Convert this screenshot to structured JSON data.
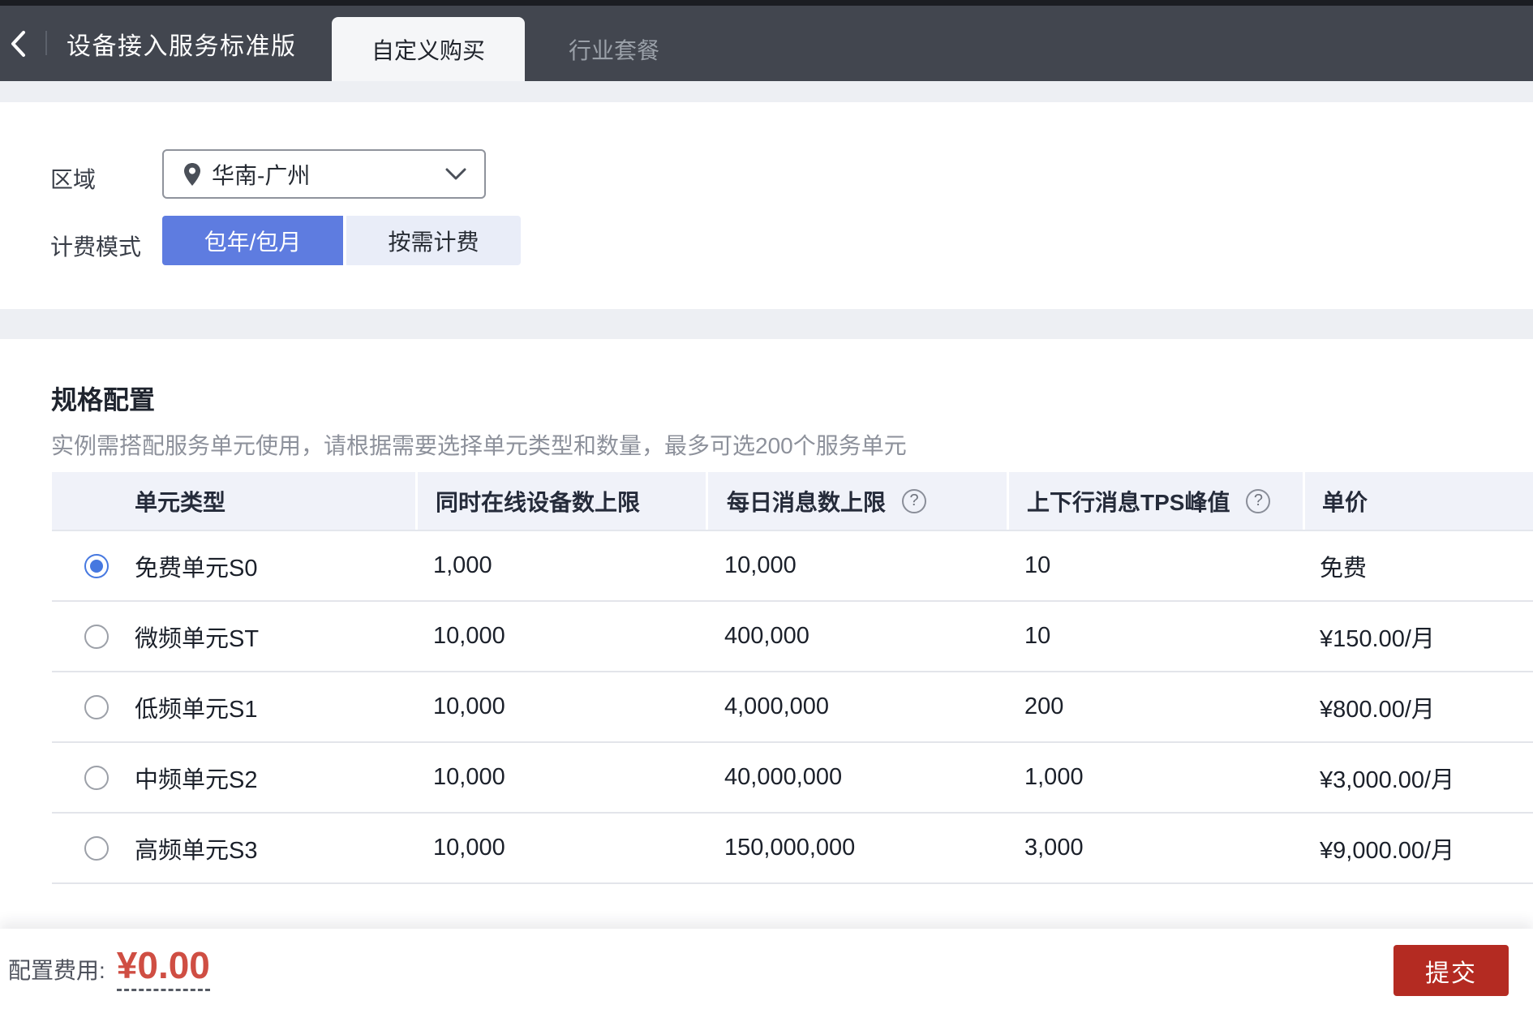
{
  "header": {
    "title": "设备接入服务标准版",
    "tabs": [
      {
        "label": "自定义购买",
        "active": true
      },
      {
        "label": "行业套餐",
        "active": false
      }
    ]
  },
  "form": {
    "region_label": "区域",
    "region_value": "华南-广州",
    "billing_label": "计费模式",
    "billing_options": [
      {
        "label": "包年/包月",
        "selected": true
      },
      {
        "label": "按需计费",
        "selected": false
      }
    ]
  },
  "spec": {
    "heading": "规格配置",
    "description": "实例需搭配服务单元使用，请根据需要选择单元类型和数量，最多可选200个服务单元"
  },
  "table": {
    "columns": [
      {
        "label": "单元类型",
        "help": false
      },
      {
        "label": "同时在线设备数上限",
        "help": false
      },
      {
        "label": "每日消息数上限",
        "help": true
      },
      {
        "label": "上下行消息TPS峰值",
        "help": true
      },
      {
        "label": "单价",
        "help": false
      }
    ],
    "rows": [
      {
        "selected": true,
        "name": "免费单元S0",
        "online": "1,000",
        "daily": "10,000",
        "tps": "10",
        "price": "免费"
      },
      {
        "selected": false,
        "name": "微频单元ST",
        "online": "10,000",
        "daily": "400,000",
        "tps": "10",
        "price": "¥150.00/月"
      },
      {
        "selected": false,
        "name": "低频单元S1",
        "online": "10,000",
        "daily": "4,000,000",
        "tps": "200",
        "price": "¥800.00/月"
      },
      {
        "selected": false,
        "name": "中频单元S2",
        "online": "10,000",
        "daily": "40,000,000",
        "tps": "1,000",
        "price": "¥3,000.00/月"
      },
      {
        "selected": false,
        "name": "高频单元S3",
        "online": "10,000",
        "daily": "150,000,000",
        "tps": "3,000",
        "price": "¥9,000.00/月"
      }
    ]
  },
  "footer": {
    "fee_label": "配置费用:",
    "fee_value": "¥0.00",
    "submit_label": "提交"
  },
  "colors": {
    "accent_blue": "#5e7ce0",
    "price_red": "#cf4e43",
    "submit_red": "#b42b22",
    "header_dark": "#42464f"
  }
}
